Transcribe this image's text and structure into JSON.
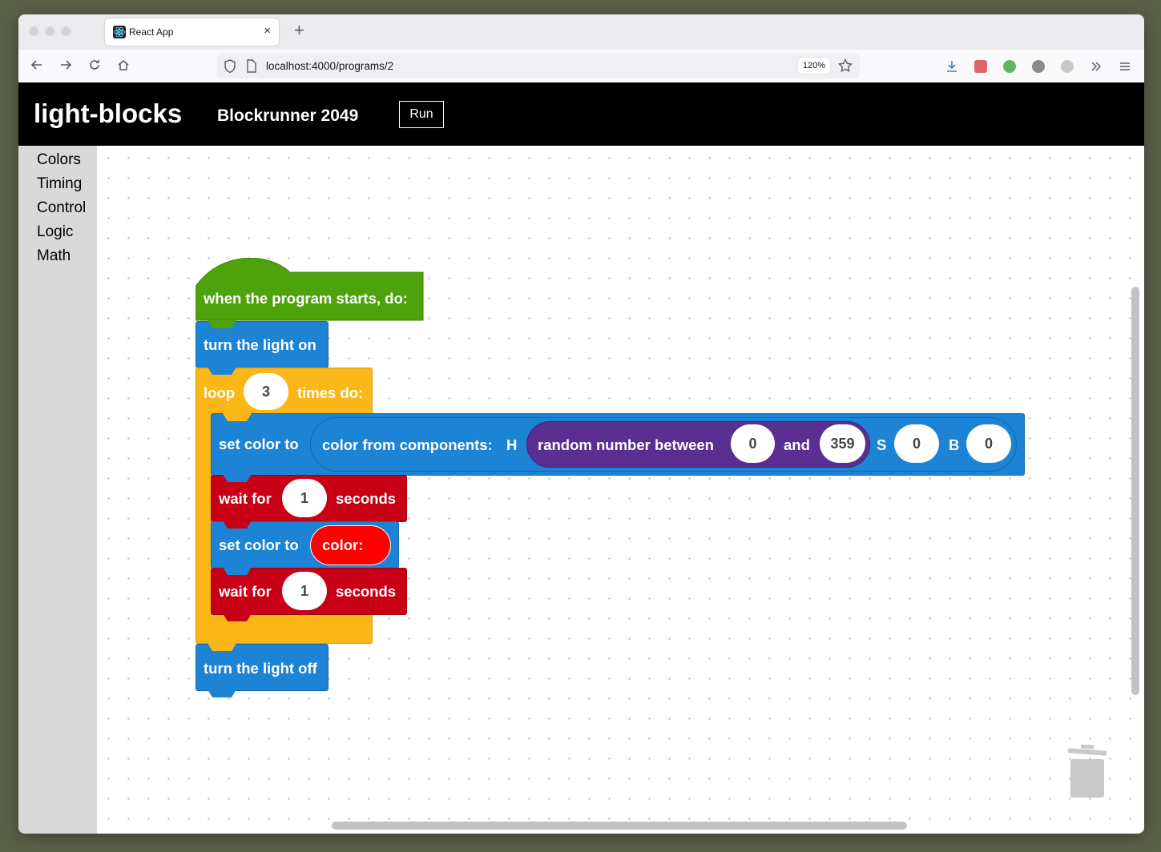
{
  "browser": {
    "tab_title": "React App",
    "tab_close": "×",
    "new_tab": "+",
    "url": "localhost:4000/programs/2",
    "zoom": "120%"
  },
  "header": {
    "app_title": "light-blocks",
    "program_name": "Blockrunner 2049",
    "run_label": "Run"
  },
  "sidebar": {
    "categories": [
      "Colors",
      "Timing",
      "Control",
      "Logic",
      "Math"
    ]
  },
  "blocks": {
    "start": "when the program starts, do:",
    "light_on": "turn the light on",
    "loop_prefix": "loop",
    "loop_count": "3",
    "loop_suffix": "times do:",
    "set_color_1": "set color to",
    "color_components": "color from components:",
    "h_label": "H",
    "random_label": "random number between",
    "random_min": "0",
    "and_label": "and",
    "random_max": "359",
    "s_label": "S",
    "s_value": "0",
    "b_label": "B",
    "b_value": "0",
    "wait_1_prefix": "wait for",
    "wait_1_value": "1",
    "wait_1_suffix": "seconds",
    "set_color_2": "set color to",
    "color_literal": "color:",
    "wait_2_prefix": "wait for",
    "wait_2_value": "1",
    "wait_2_suffix": "seconds",
    "light_off": "turn the light off"
  },
  "colors": {
    "event": "#4ea30c",
    "action": "#1d83d4",
    "control": "#fbb718",
    "timing": "#c80016",
    "math": "#5b2e91",
    "color_value": "#ff0000"
  }
}
